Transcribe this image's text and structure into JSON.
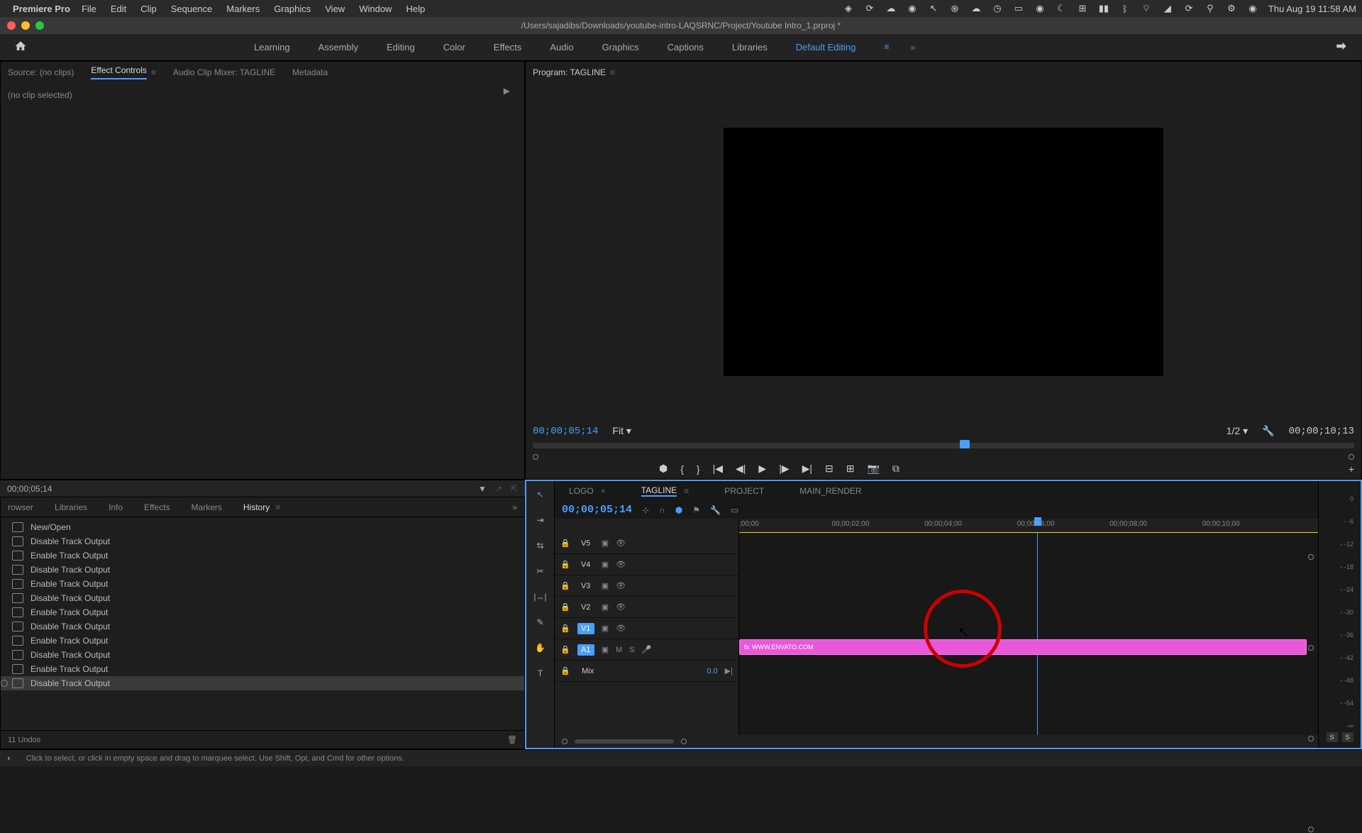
{
  "menubar": {
    "appname": "Premiere Pro",
    "items": [
      "File",
      "Edit",
      "Clip",
      "Sequence",
      "Markers",
      "Graphics",
      "View",
      "Window",
      "Help"
    ],
    "datetime": "Thu Aug 19  11:58 AM"
  },
  "titlebar": {
    "path": "/Users/sajadibs/Downloads/youtube-intro-LAQSRNC/Project/Youtube Intro_1.prproj *"
  },
  "workspaces": {
    "items": [
      "Learning",
      "Assembly",
      "Editing",
      "Color",
      "Effects",
      "Audio",
      "Graphics",
      "Captions",
      "Libraries",
      "Default Editing"
    ],
    "active": "Default Editing"
  },
  "source": {
    "tabs": [
      "Source: (no clips)",
      "Effect Controls",
      "Audio Clip Mixer: TAGLINE",
      "Metadata"
    ],
    "active_tab": "Effect Controls",
    "content": "(no clip selected)",
    "timecode": "00;00;05;14"
  },
  "project": {
    "tabs": [
      "rowser",
      "Libraries",
      "Info",
      "Effects",
      "Markers",
      "History"
    ],
    "active_tab": "History",
    "history": [
      "New/Open",
      "Disable Track Output",
      "Enable Track Output",
      "Disable Track Output",
      "Enable Track Output",
      "Disable Track Output",
      "Enable Track Output",
      "Disable Track Output",
      "Enable Track Output",
      "Disable Track Output",
      "Enable Track Output",
      "Disable Track Output"
    ],
    "undos": "11 Undos"
  },
  "program": {
    "title": "Program: TAGLINE",
    "timecode": "00;00;05;14",
    "fit": "Fit",
    "zoom": "1/2",
    "duration": "00;00;10;13"
  },
  "timeline": {
    "tabs": [
      "LOGO",
      "TAGLINE",
      "PROJECT",
      "MAIN_RENDER"
    ],
    "active_tab": "TAGLINE",
    "timecode": "00;00;05;14",
    "ruler": [
      ";00;00",
      "00;00;02;00",
      "00;00;04;00",
      "00;00;06;00",
      "00;00;08;00",
      "00;00;10;00"
    ],
    "tracks": {
      "video": [
        "V5",
        "V4",
        "V3",
        "V2",
        "V1"
      ],
      "audio": [
        "A1"
      ],
      "mix": "Mix",
      "mix_val": "0.0"
    },
    "clip": {
      "label": "WWW.ENVATO.COM"
    }
  },
  "audio_meter": {
    "scale": [
      "0",
      "- -6",
      "- -12",
      "- -18",
      "- -24",
      "- -30",
      "- -36",
      "- -42",
      "- -48",
      "- -54",
      "-∞"
    ],
    "solo": "S"
  },
  "statusbar": {
    "hint": "Click to select, or click in empty space and drag to marquee select. Use Shift, Opt, and Cmd for other options."
  }
}
